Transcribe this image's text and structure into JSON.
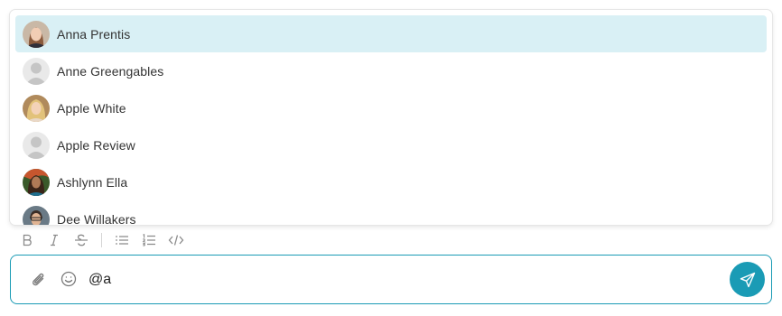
{
  "mentions": {
    "items": [
      {
        "name": "Anna Prentis",
        "avatar": "photo-avatar",
        "active": true
      },
      {
        "name": "Anne Greengables",
        "avatar": "placeholder-avatar",
        "active": false
      },
      {
        "name": "Apple White",
        "avatar": "photo-avatar",
        "active": false
      },
      {
        "name": "Apple Review",
        "avatar": "placeholder-avatar",
        "active": false
      },
      {
        "name": "Ashlynn Ella",
        "avatar": "photo-avatar",
        "active": false
      },
      {
        "name": "Dee Willakers",
        "avatar": "photo-avatar",
        "active": false
      }
    ]
  },
  "toolbar": {
    "icons": [
      "bold-icon",
      "italic-icon",
      "strikethrough-icon",
      "bullet-list-icon",
      "numbered-list-icon",
      "code-icon"
    ]
  },
  "composer": {
    "value": "@a",
    "icons": [
      "paperclip-icon",
      "emoji-icon",
      "send-icon"
    ]
  },
  "colors": {
    "accent": "#1a9bb5",
    "active_row": "#d9f0f5",
    "toolbar_icon": "#8a8a8a"
  }
}
